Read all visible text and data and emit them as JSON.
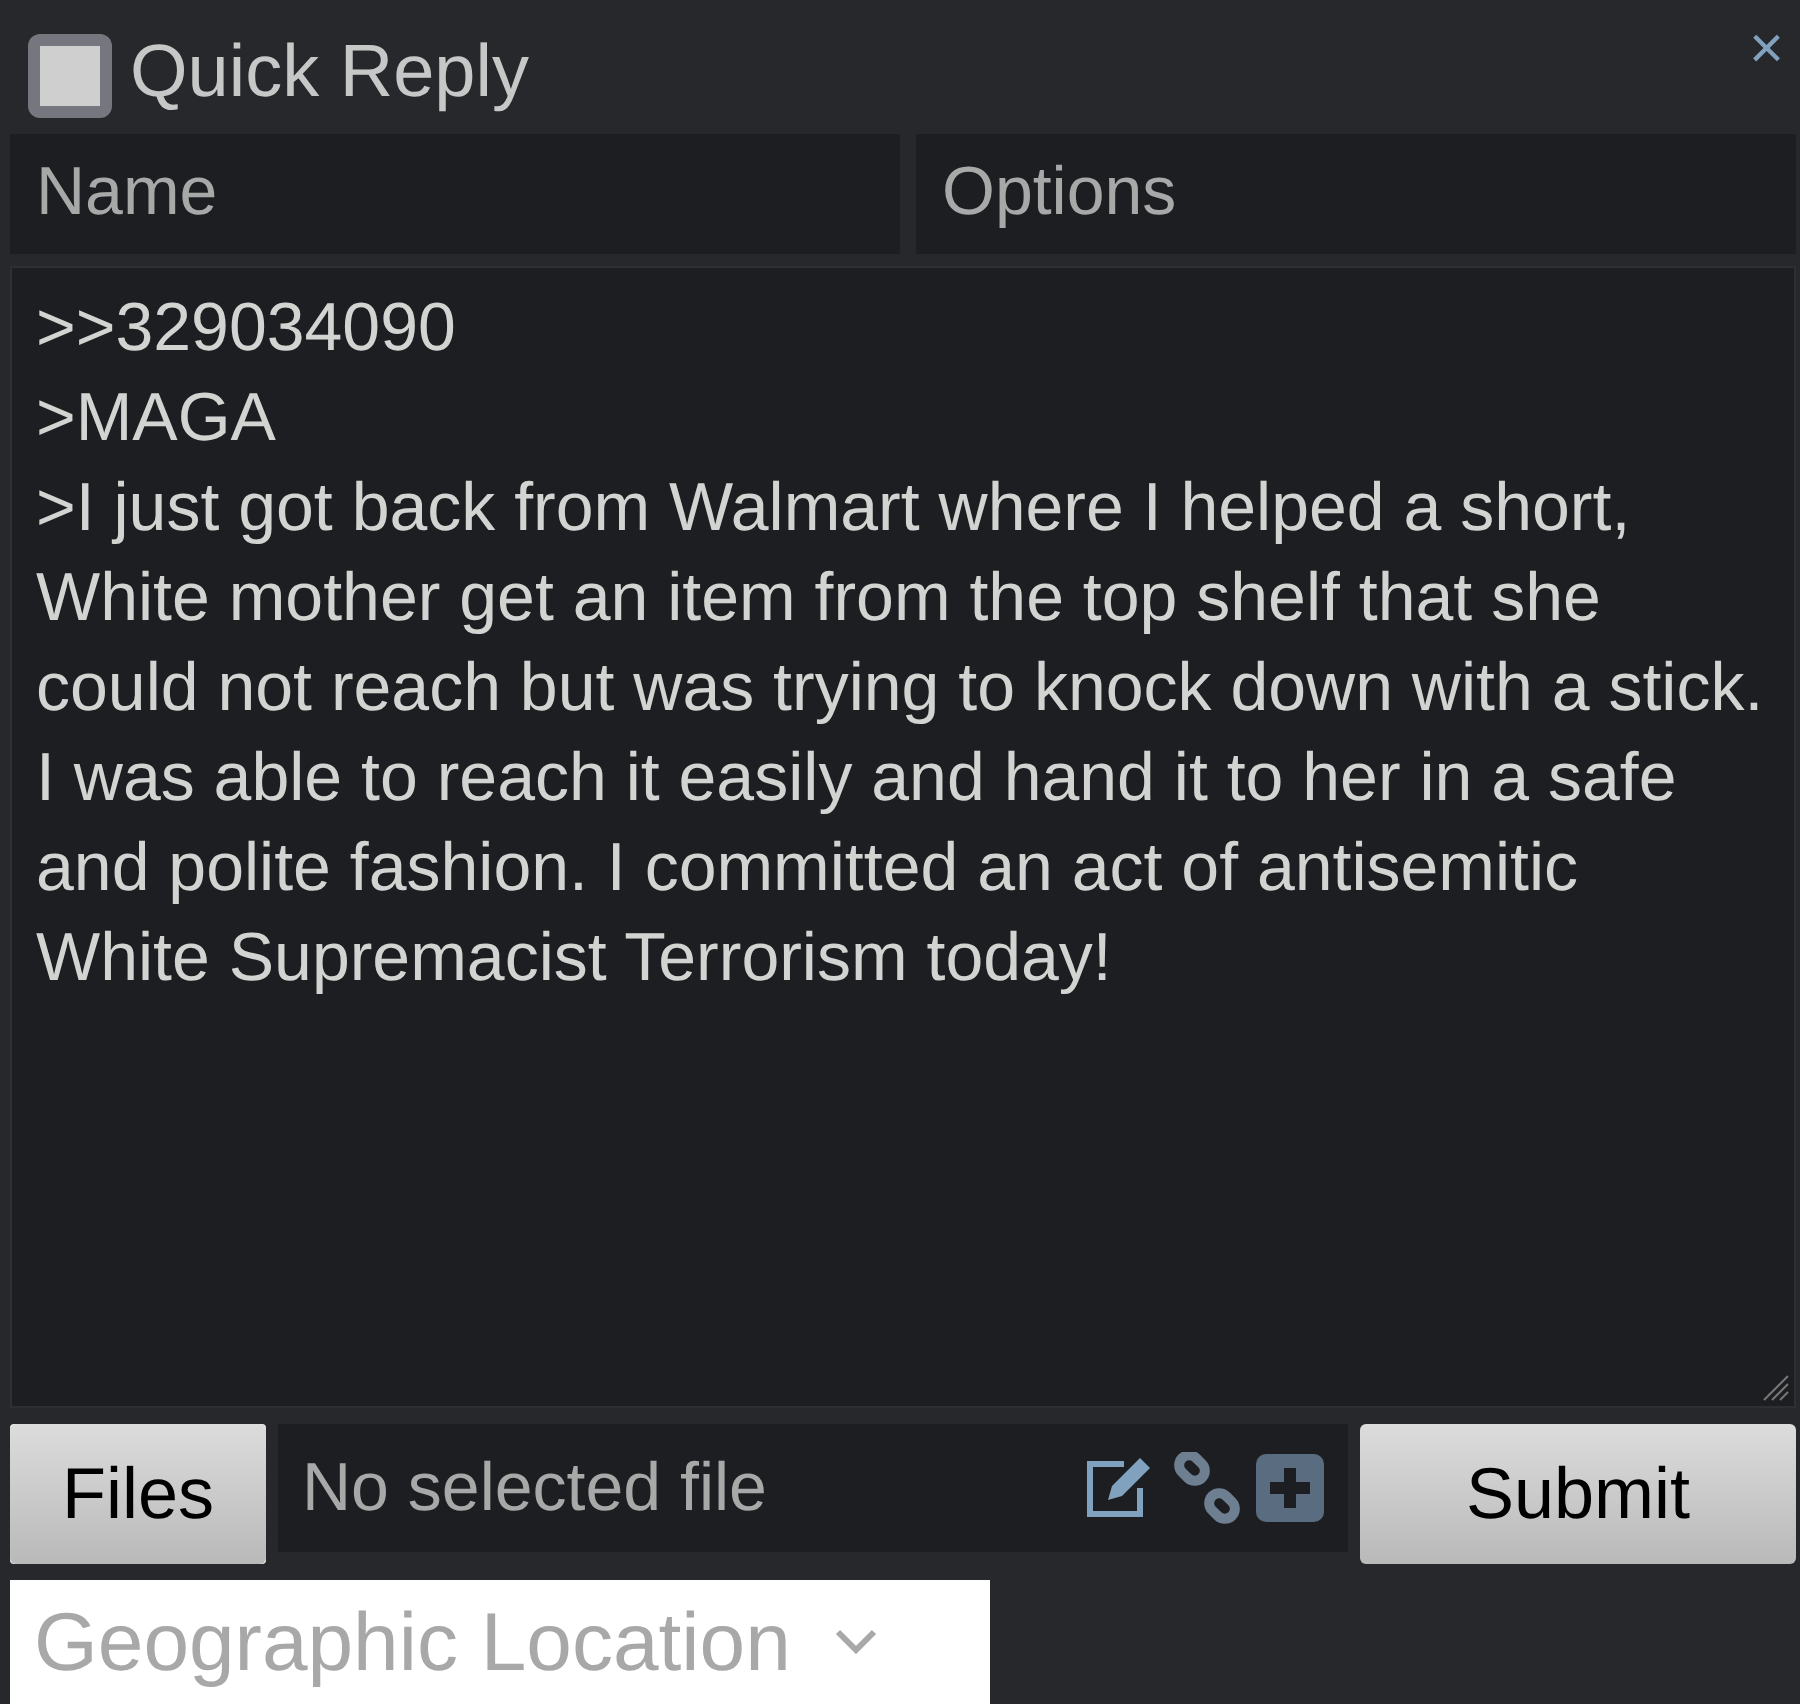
{
  "window": {
    "title": "Quick Reply",
    "checked": false,
    "close": "×"
  },
  "fields": [
    {
      "placeholder": "Name"
    },
    {
      "placeholder": "Options"
    }
  ],
  "comment": {
    "value": ">>329034090\n>MAGA\n>I just got back from Walmart where I helped a short, White mother get an item from the top shelf that she could not reach but was trying to knock down with a stick. I was able to reach it easily and hand it to her in a safe and polite fashion. I committed an act of antisemitic White Supremacist Terrorism today!"
  },
  "files": {
    "button": "Files",
    "status": "No selected file"
  },
  "submit": "Submit",
  "location": {
    "placeholder": "Geographic Location"
  }
}
